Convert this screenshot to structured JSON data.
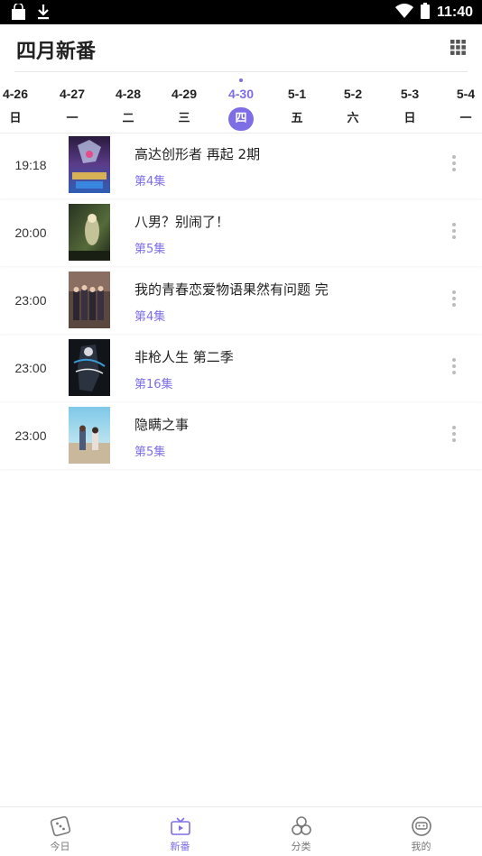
{
  "status_bar": {
    "time": "11:40"
  },
  "header": {
    "title": "四月新番"
  },
  "days": [
    {
      "date": "4-26",
      "weekday": "日",
      "active": false
    },
    {
      "date": "4-27",
      "weekday": "一",
      "active": false
    },
    {
      "date": "4-28",
      "weekday": "二",
      "active": false
    },
    {
      "date": "4-29",
      "weekday": "三",
      "active": false
    },
    {
      "date": "4-30",
      "weekday": "四",
      "active": true
    },
    {
      "date": "5-1",
      "weekday": "五",
      "active": false
    },
    {
      "date": "5-2",
      "weekday": "六",
      "active": false
    },
    {
      "date": "5-3",
      "weekday": "日",
      "active": false
    },
    {
      "date": "5-4",
      "weekday": "一",
      "active": false
    }
  ],
  "schedule": [
    {
      "time": "19:18",
      "title": "高达创形者 再起 2期",
      "episode": "第4集"
    },
    {
      "time": "20:00",
      "title": "八男？别闹了！",
      "episode": "第5集"
    },
    {
      "time": "23:00",
      "title": "我的青春恋爱物语果然有问题 完",
      "episode": "第4集"
    },
    {
      "time": "23:00",
      "title": "非枪人生 第二季",
      "episode": "第16集"
    },
    {
      "time": "23:00",
      "title": "隐瞒之事",
      "episode": "第5集"
    }
  ],
  "tabs": [
    {
      "label": "今日",
      "icon": "dice-icon",
      "active": false
    },
    {
      "label": "新番",
      "icon": "tv-icon",
      "active": true
    },
    {
      "label": "分类",
      "icon": "circles-icon",
      "active": false
    },
    {
      "label": "我的",
      "icon": "robot-face-icon",
      "active": false
    }
  ],
  "colors": {
    "accent": "#7e6ee6",
    "status_bar": "#000000"
  }
}
